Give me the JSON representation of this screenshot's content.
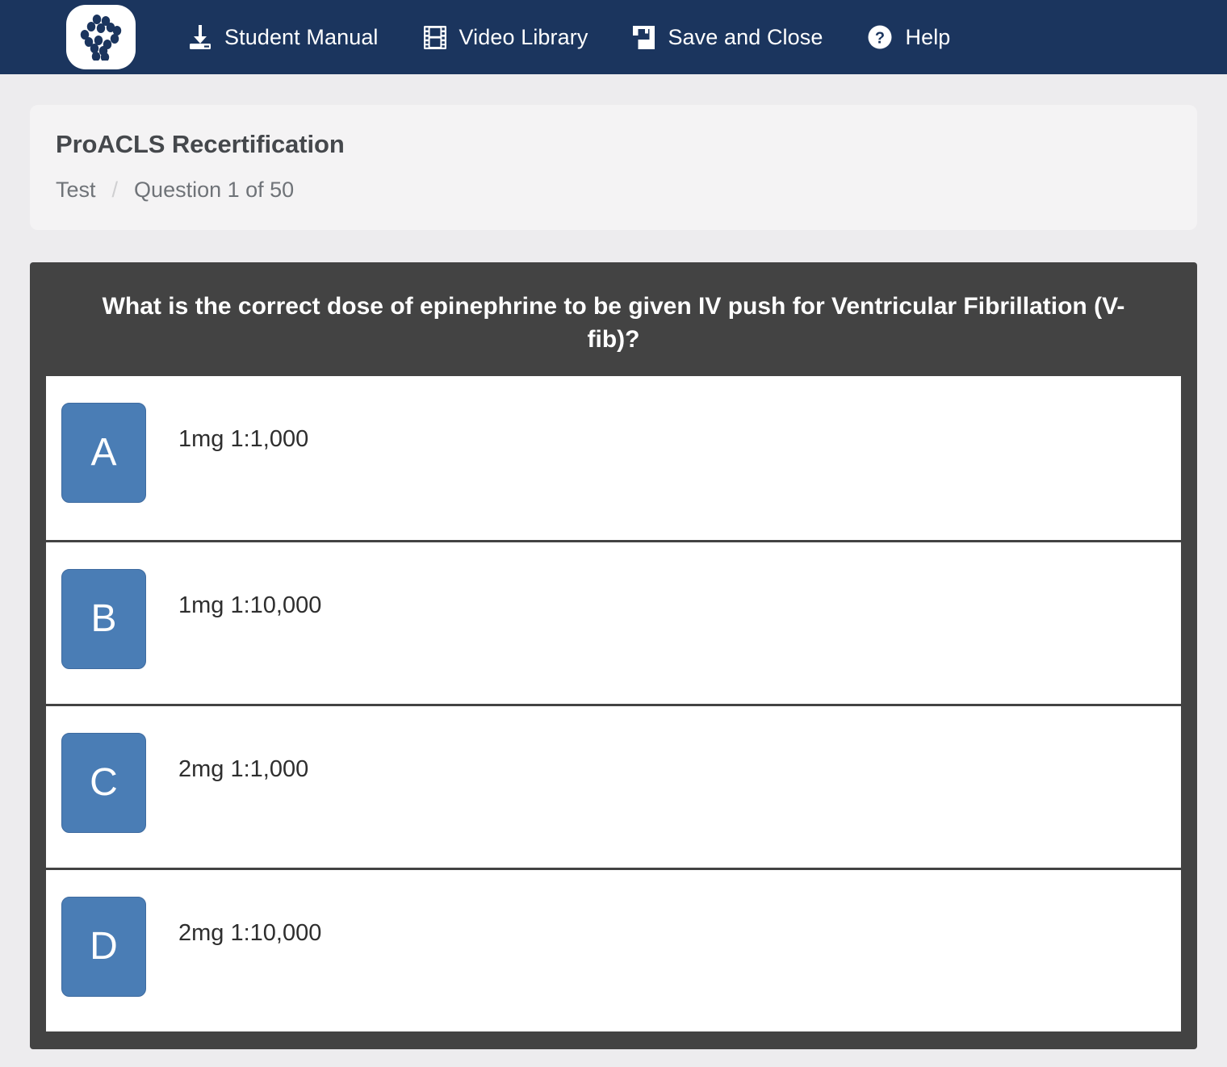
{
  "navbar": {
    "logo_name": "proacls-logo",
    "background_color": "#1b355e",
    "items": [
      {
        "label": "Student Manual",
        "icon": "download-icon"
      },
      {
        "label": "Video Library",
        "icon": "film-strip-icon"
      },
      {
        "label": "Save and Close",
        "icon": "floppy-disk-save-icon"
      },
      {
        "label": "Help",
        "icon": "question-circle-icon"
      }
    ]
  },
  "header": {
    "title": "ProACLS Recertification",
    "breadcrumb": {
      "root": "Test",
      "separator": "/",
      "current": "Question 1 of 50"
    }
  },
  "question": {
    "text": "What is the correct dose of epinephrine to be given IV push for Ventricular Fibrillation (V-fib)?",
    "card_color": "#434343",
    "options": [
      {
        "letter": "A",
        "text": "1mg 1:1,000"
      },
      {
        "letter": "B",
        "text": "1mg 1:10,000"
      },
      {
        "letter": "C",
        "text": "2mg 1:1,000"
      },
      {
        "letter": "D",
        "text": "2mg 1:10,000"
      }
    ],
    "badge_color": "#4a7db5"
  }
}
